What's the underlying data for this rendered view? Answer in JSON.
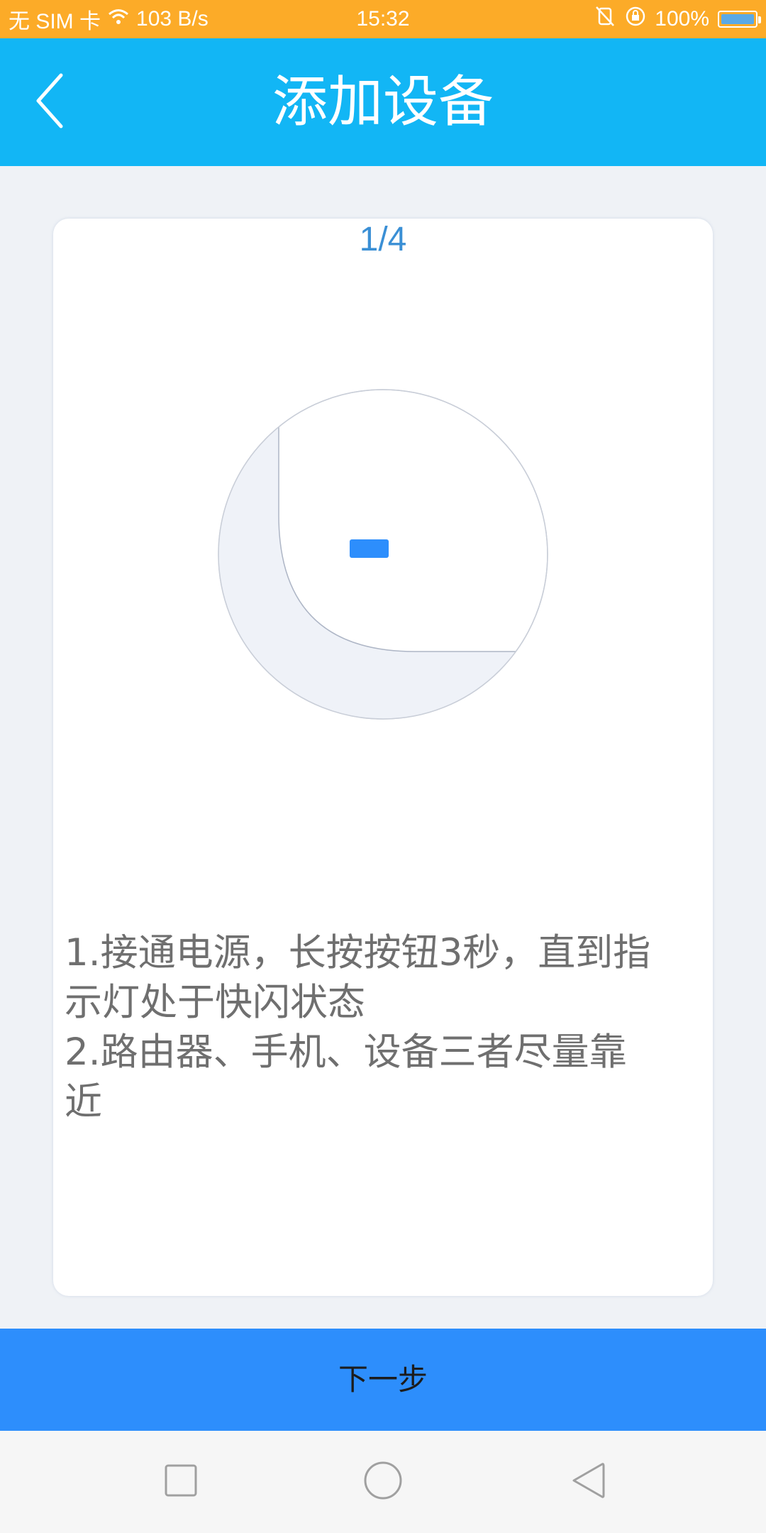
{
  "status_bar": {
    "carrier": "无 SIM 卡",
    "net_speed": "103 B/s",
    "time": "15:32",
    "battery": "100%"
  },
  "header": {
    "title": "添加设备",
    "back_icon": "chevron-left-icon"
  },
  "card": {
    "step": "1/4",
    "illustration_icon": "device-reset-button-icon",
    "instructions": [
      "1.接通电源，长按按钮3秒，直到指\n示灯处于快闪状态",
      "2.路由器、手机、设备三者尽量靠\n近"
    ]
  },
  "next_button": {
    "label": "下一步"
  },
  "nav_bar": {
    "recent_icon": "square-icon",
    "home_icon": "circle-icon",
    "back_icon": "triangle-back-icon"
  },
  "colors": {
    "status_bar": "#fcab28",
    "header": "#12b6f5",
    "accent_button": "#2d8efc",
    "step_text": "#3a8fd5",
    "page_background": "#eff2f6"
  }
}
